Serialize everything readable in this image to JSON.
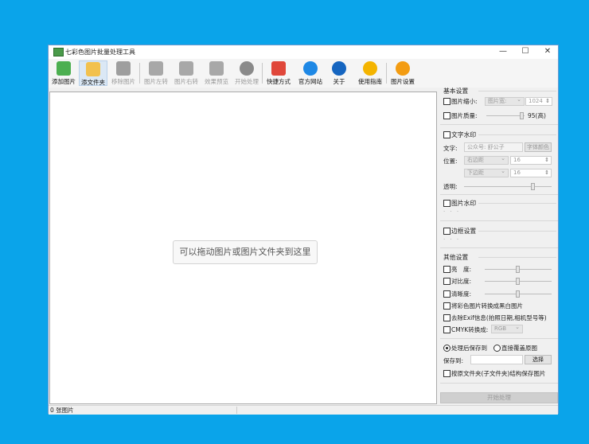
{
  "window": {
    "title": "七彩色图片批量处理工具",
    "minimize_glyph": "—",
    "maximize_glyph": "☐",
    "close_glyph": "✕"
  },
  "toolbar": {
    "buttons": [
      {
        "label": "添加图片",
        "icon": "add-image-icon",
        "color": "#4caf50",
        "enabled": true
      },
      {
        "label": "添文件夹",
        "icon": "add-folder-icon",
        "color": "#f2c14e",
        "enabled": true,
        "selected": true
      },
      {
        "label": "移除图片",
        "icon": "remove-image-icon",
        "color": "#9e9e9e",
        "enabled": false
      },
      {
        "label": "图片左转",
        "icon": "rotate-left-icon",
        "color": "#a8a8a8",
        "enabled": false
      },
      {
        "label": "图片右转",
        "icon": "rotate-right-icon",
        "color": "#a8a8a8",
        "enabled": false
      },
      {
        "label": "效果预览",
        "icon": "magnifier-icon",
        "color": "#a8a8a8",
        "enabled": false
      },
      {
        "label": "开始处理",
        "icon": "play-icon",
        "color": "#8a8a8a",
        "enabled": false
      },
      {
        "label": "快捷方式",
        "icon": "shortcut-blocks-icon",
        "color": "#e0473a",
        "enabled": true
      },
      {
        "label": "官方网站",
        "icon": "ie-browser-icon",
        "color": "#1e88e5",
        "enabled": true
      },
      {
        "label": "关于",
        "icon": "info-icon",
        "color": "#1565c0",
        "enabled": true
      },
      {
        "label": "使用指南",
        "icon": "help-icon",
        "color": "#f4b400",
        "enabled": true
      },
      {
        "label": "图片设置",
        "icon": "gear-icon",
        "color": "#f39c12",
        "enabled": true
      }
    ]
  },
  "canvas": {
    "drop_hint": "可以拖动图片或图片文件夹到这里"
  },
  "status": {
    "count": "0 张图片"
  },
  "settings": {
    "basic": {
      "title": "基本设置",
      "shrink_label": "图片缩小:",
      "shrink_mode": "图片宽:",
      "shrink_value": "1024",
      "quality_label": "图片质量:",
      "quality_value": "95(高)",
      "quality_level": 0.95
    },
    "text_watermark": {
      "title": "文字水印",
      "text_label": "文字:",
      "text_placeholder": "公众号: 舒公子",
      "font_color_button": "字体颜色",
      "position_label": "位置:",
      "h_position": "右边距",
      "h_value": "16",
      "v_position": "下边距",
      "v_value": "16",
      "opacity_label": "透明:"
    },
    "image_watermark": {
      "title": "图片水印",
      "dots": "· · ·"
    },
    "border": {
      "title": "边框设置",
      "dots": "· · ·"
    },
    "other": {
      "title": "其他设置",
      "brightness_label": "亮　度:",
      "contrast_label": "对比度:",
      "sharpness_label": "清晰度:",
      "to_bw_label": "将彩色图片转换成黑白图片",
      "remove_exif_label": "去除Exif信息(拍照日期,相机型号等)",
      "cmyk_label": "CMYK转换成:",
      "cmyk_target": "RGB"
    },
    "output": {
      "save_after_label": "处理后保存到",
      "overwrite_label": "直接覆盖原图",
      "save_to_label": "保存到:",
      "save_to_value": "",
      "choose_button": "选择",
      "keep_structure_label": "按原文件夹(子文件夹)结构保存图片"
    },
    "start_button": "开始处理"
  }
}
